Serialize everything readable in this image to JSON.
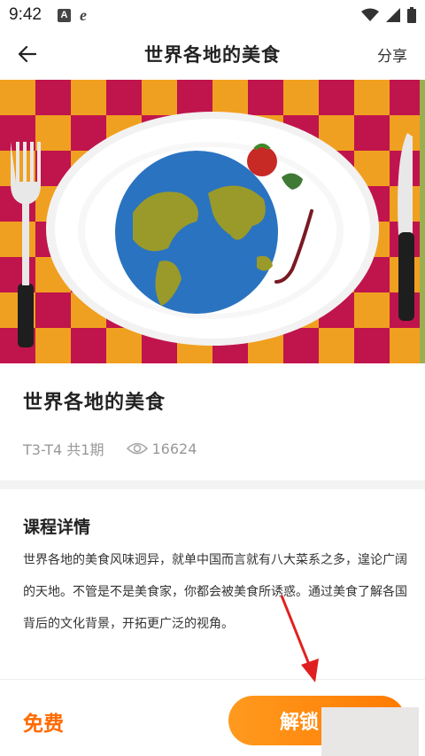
{
  "status_bar": {
    "time": "9:42",
    "icon_a": "A",
    "icon_e": "e"
  },
  "header": {
    "title": "世界各地的美食",
    "share_label": "分享"
  },
  "course": {
    "title": "世界各地的美食",
    "meta": "T3-T4 共1期",
    "views": "16624"
  },
  "detail": {
    "heading": "课程详情",
    "text": "世界各地的美食风味迥异，就单中国而言就有八大菜系之多，遑论广阔的天地。不管是不是美食家，你都会被美食所诱惑。通过美食了解各国背后的文化背景，开拓更广泛的视角。"
  },
  "footer": {
    "free_label": "免费",
    "unlock_label": "解锁"
  },
  "colors": {
    "accent": "#ff7a00",
    "checker_red": "#c0144c",
    "checker_orange": "#f0a020"
  },
  "icons": [
    "back-arrow-icon",
    "eye-icon",
    "wifi-icon",
    "signal-icon",
    "battery-icon"
  ]
}
